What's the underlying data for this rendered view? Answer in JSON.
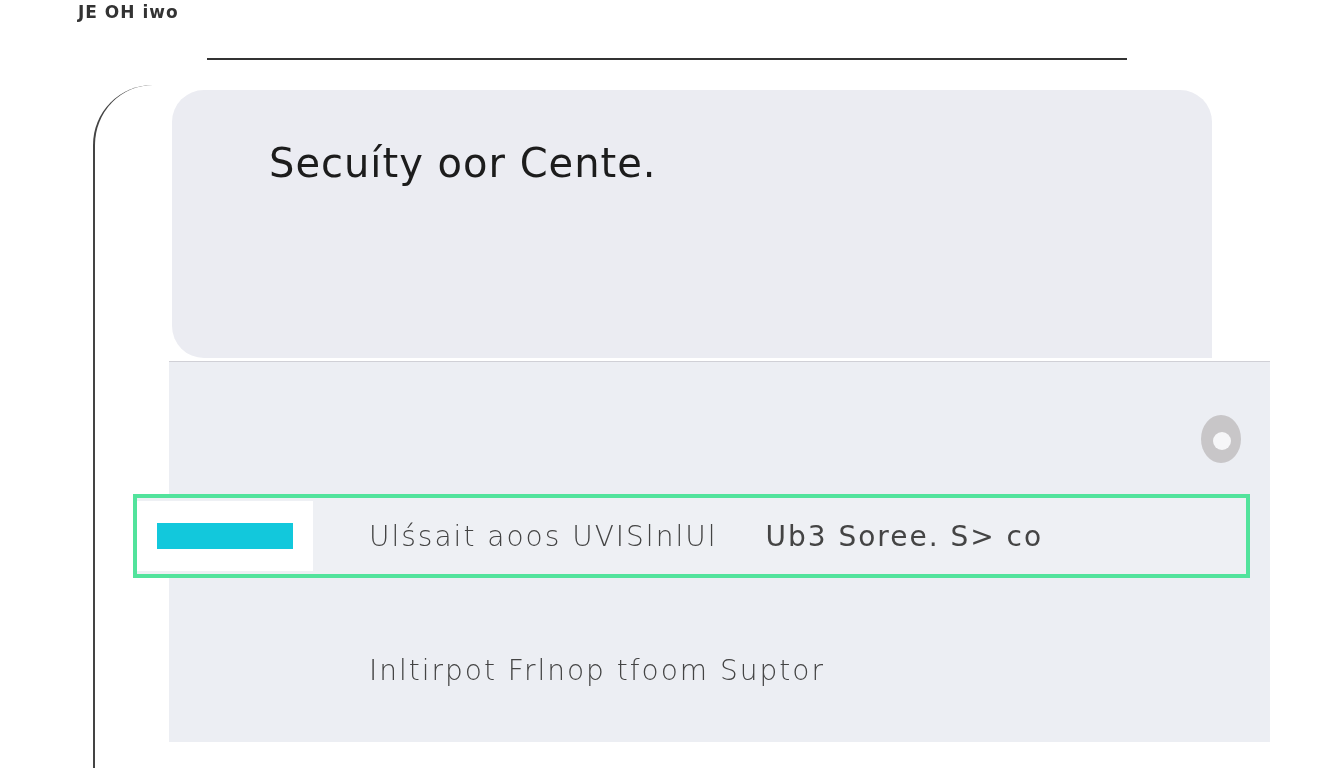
{
  "header": {
    "logo_text": "JE OH iwo"
  },
  "card": {
    "title": "Secuíty oor Cente."
  },
  "panel": {
    "rows": [
      {
        "label": "Ulśsait aoos UVISlnlUl",
        "value": "Ub3 Soree. S> co",
        "selected": true
      },
      {
        "label": "Inltirpot Frlnop tfoom Suptor",
        "selected": false
      }
    ]
  }
}
